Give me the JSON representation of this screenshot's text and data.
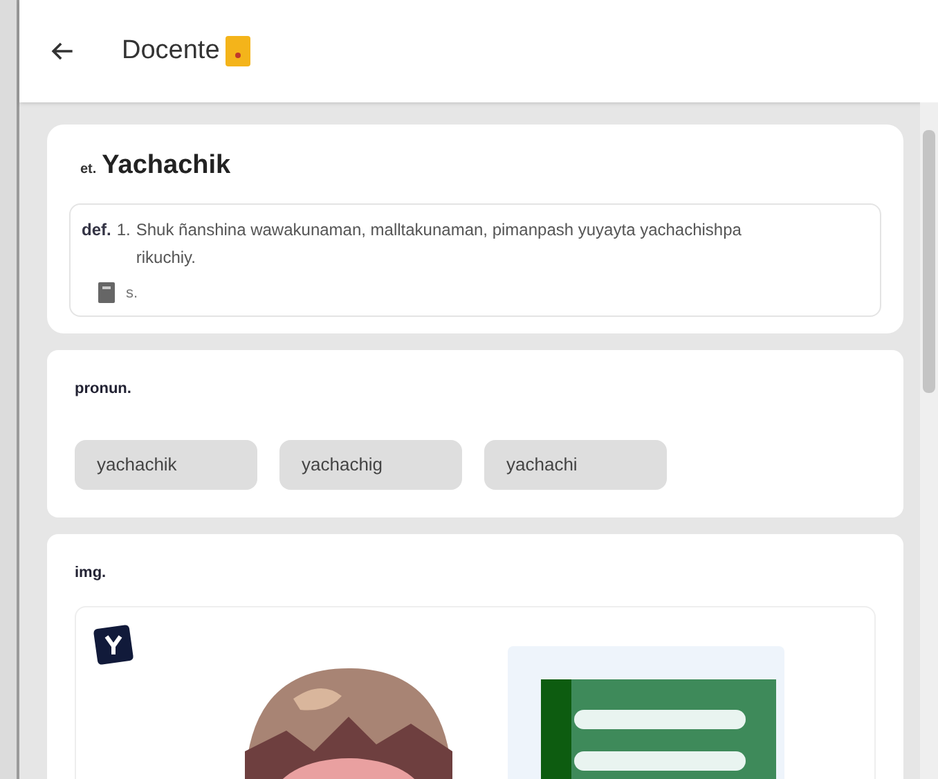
{
  "header": {
    "title": "Docente"
  },
  "entry": {
    "tag": "et.",
    "word": "Yachachik",
    "definition": {
      "label": "def.",
      "number": "1.",
      "text": "Shuk ñanshina wawakunaman, malltakunaman, pimanpash yuyayta yachachishpa rikuchiy.",
      "source": "s."
    }
  },
  "pronunciation": {
    "label": "pronun.",
    "variants": [
      "yachachik",
      "yachachig",
      "yachachi"
    ]
  },
  "images": {
    "label": "img."
  }
}
